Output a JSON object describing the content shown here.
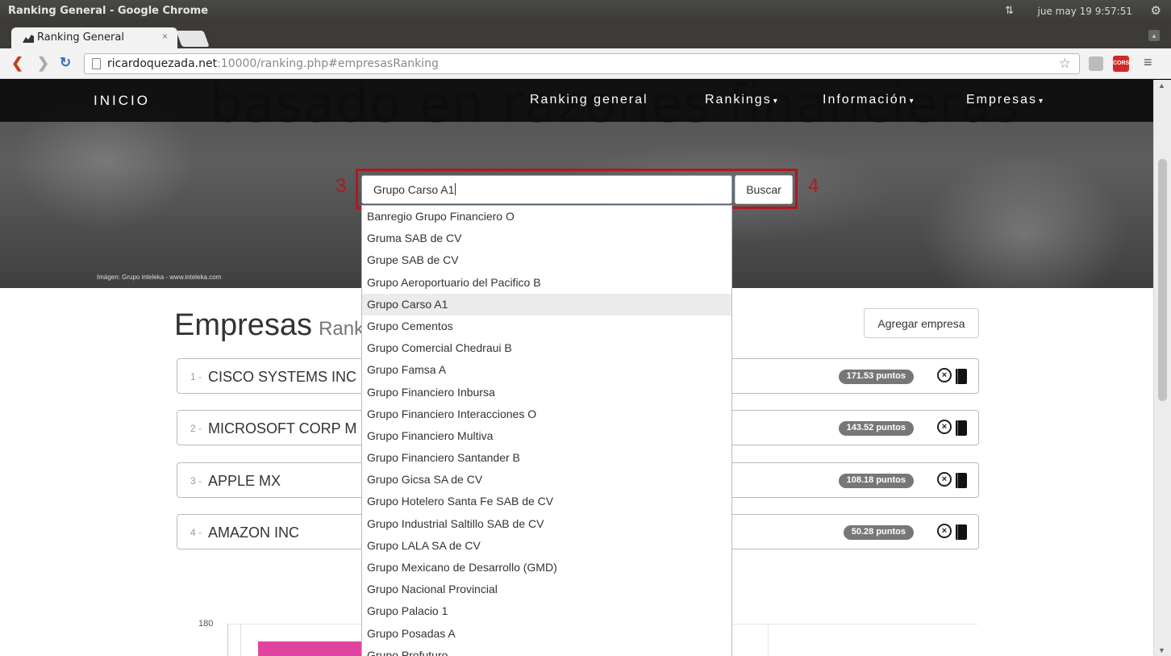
{
  "os": {
    "window_title": "Ranking General - Google Chrome",
    "clock": "jue may 19  9:57:51"
  },
  "browser": {
    "tab_title": "Ranking General",
    "tab_close": "×",
    "url_host": "ricardoquezada.net",
    "url_rest": ":10000/ranking.php#empresasRanking",
    "ext_label": "CORS"
  },
  "hero": {
    "watermark": "basado en razones financieras",
    "credit": "Imágen: Grupo inteleka - www.inteleka.com"
  },
  "navbar": {
    "brand": "INICIO",
    "items": [
      {
        "label": "Ranking general",
        "caret": ""
      },
      {
        "label": "Rankings",
        "caret": "▾"
      },
      {
        "label": "Información",
        "caret": "▾"
      },
      {
        "label": "Empresas",
        "caret": "▾"
      }
    ]
  },
  "search": {
    "value": "Grupo Carso A1",
    "button": "Buscar",
    "annotation_left": "3",
    "annotation_right": "4",
    "accent": "#b1171f"
  },
  "suggestions": [
    "Banregio Grupo Financiero O",
    "Gruma SAB de CV",
    "Grupe SAB de CV",
    "Grupo Aeroportuario del Pacifico B",
    "Grupo Carso A1",
    "Grupo Cementos",
    "Grupo Comercial Chedraui B",
    "Grupo Famsa A",
    "Grupo Financiero Inbursa",
    "Grupo Financiero Interacciones O",
    "Grupo Financiero Multiva",
    "Grupo Financiero Santander B",
    "Grupo Gicsa SA de CV",
    "Grupo Hotelero Santa Fe SAB de CV",
    "Grupo Industrial Saltillo SAB de CV",
    "Grupo LALA SA de CV",
    "Grupo Mexicano de Desarrollo (GMD)",
    "Grupo Nacional Provincial",
    "Grupo Palacio 1",
    "Grupo Posadas A",
    "Grupo Profuturo"
  ],
  "active_suggestion": 4,
  "page": {
    "title": "Empresas",
    "subtitle": "Ranking",
    "add_button": "Agregar empresa"
  },
  "ranking": [
    {
      "num": "1 -",
      "name": "CISCO SYSTEMS INC",
      "score": "171.53 puntos"
    },
    {
      "num": "2 -",
      "name": "MICROSOFT CORP M",
      "score": "143.52 puntos"
    },
    {
      "num": "3 -",
      "name": "APPLE MX",
      "score": "108.18 puntos"
    },
    {
      "num": "4 -",
      "name": "AMAZON INC",
      "score": "50.28 puntos"
    }
  ],
  "chart": {
    "y_tick": "180",
    "bar_color": "#e0449f"
  }
}
